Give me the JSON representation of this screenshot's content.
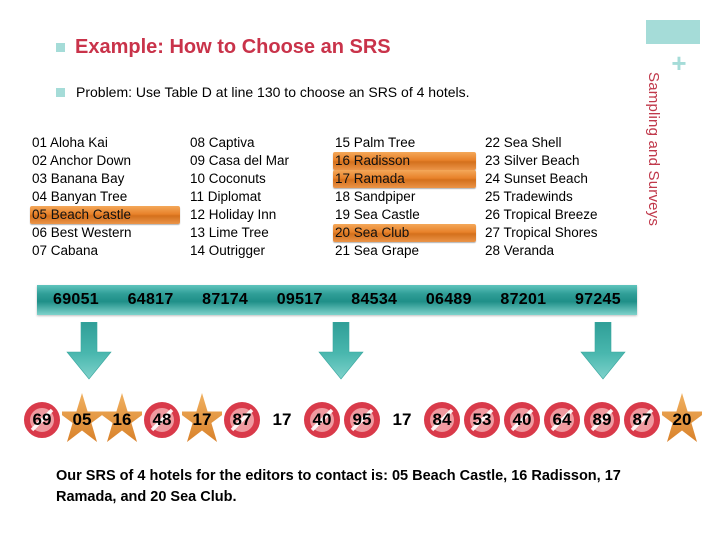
{
  "sidebar": {
    "vertical_title": "Sampling and Surveys",
    "plus_glyph": "+",
    "swatch_color": "#a5dcd8",
    "title_color": "#c0394b"
  },
  "heading": {
    "title": "Example: How to Choose an SRS",
    "title_color": "#c9334a",
    "bullet_color": "#a5dcd8"
  },
  "problem": {
    "text": "Problem: Use Table D at line 130 to choose an SRS of 4 hotels."
  },
  "hotel_list": {
    "highlight_color": "#e8822a",
    "columns": [
      [
        {
          "label": "01 Aloha Kai",
          "highlighted": false
        },
        {
          "label": "02 Anchor Down",
          "highlighted": false
        },
        {
          "label": "03 Banana Bay",
          "highlighted": false
        },
        {
          "label": "04 Banyan Tree",
          "highlighted": false
        },
        {
          "label": "05 Beach Castle",
          "highlighted": true
        },
        {
          "label": "06 Best Western",
          "highlighted": false
        },
        {
          "label": "07 Cabana",
          "highlighted": false
        }
      ],
      [
        {
          "label": "08 Captiva",
          "highlighted": false
        },
        {
          "label": "09 Casa del Mar",
          "highlighted": false
        },
        {
          "label": "10 Coconuts",
          "highlighted": false
        },
        {
          "label": "11 Diplomat",
          "highlighted": false
        },
        {
          "label": "12 Holiday Inn",
          "highlighted": false
        },
        {
          "label": "13 Lime Tree",
          "highlighted": false
        },
        {
          "label": "14 Outrigger",
          "highlighted": false
        }
      ],
      [
        {
          "label": "15 Palm Tree",
          "highlighted": false
        },
        {
          "label": "16 Radisson",
          "highlighted": true
        },
        {
          "label": "17 Ramada",
          "highlighted": true
        },
        {
          "label": "18 Sandpiper",
          "highlighted": false
        },
        {
          "label": "19 Sea Castle",
          "highlighted": false
        },
        {
          "label": "20 Sea Club",
          "highlighted": true
        },
        {
          "label": "21 Sea Grape",
          "highlighted": false
        }
      ],
      [
        {
          "label": "22 Sea Shell",
          "highlighted": false
        },
        {
          "label": "23 Silver Beach",
          "highlighted": false
        },
        {
          "label": "24 Sunset Beach",
          "highlighted": false
        },
        {
          "label": "25 Tradewinds",
          "highlighted": false
        },
        {
          "label": "26 Tropical Breeze",
          "highlighted": false
        },
        {
          "label": "27 Tropical Shores",
          "highlighted": false
        },
        {
          "label": "28 Veranda",
          "highlighted": false
        }
      ]
    ]
  },
  "digit_banner": {
    "groups": [
      "69051",
      "64817",
      "87174",
      "09517",
      "84534",
      "06489",
      "87201",
      "97245"
    ],
    "background_color": "#2f9e97"
  },
  "arrows": {
    "color": "#3aa8a0",
    "positions": [
      66,
      318,
      580
    ]
  },
  "number_row": {
    "circle_color": "#d93a4a",
    "star_color": "#e49a3c",
    "items": [
      {
        "value": "69",
        "mark": "circle"
      },
      {
        "value": "05",
        "mark": "star"
      },
      {
        "value": "16",
        "mark": "star"
      },
      {
        "value": "48",
        "mark": "circle"
      },
      {
        "value": "17",
        "mark": "star"
      },
      {
        "value": "87",
        "mark": "circle"
      },
      {
        "value": "17",
        "mark": "none"
      },
      {
        "value": "40",
        "mark": "circle"
      },
      {
        "value": "95",
        "mark": "circle"
      },
      {
        "value": "17",
        "mark": "none"
      },
      {
        "value": "84",
        "mark": "circle"
      },
      {
        "value": "53",
        "mark": "circle"
      },
      {
        "value": "40",
        "mark": "circle"
      },
      {
        "value": "64",
        "mark": "circle"
      },
      {
        "value": "89",
        "mark": "circle"
      },
      {
        "value": "87",
        "mark": "circle"
      },
      {
        "value": "20",
        "mark": "star"
      }
    ]
  },
  "conclusion": {
    "text": "Our SRS of 4 hotels for the editors to contact is: 05 Beach Castle, 16 Radisson, 17 Ramada, and 20 Sea Club."
  }
}
